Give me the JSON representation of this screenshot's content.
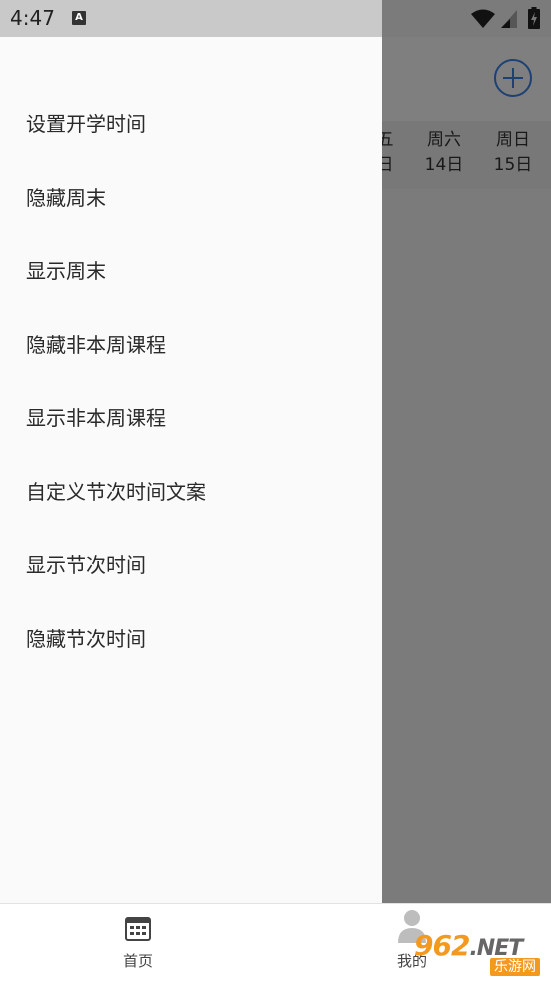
{
  "status_bar": {
    "time": "4:47",
    "notification_icon": "A"
  },
  "app": {
    "week_days": [
      {
        "name": "五",
        "date": "日"
      },
      {
        "name": "周六",
        "date": "14日"
      },
      {
        "name": "周日",
        "date": "15日"
      }
    ],
    "add_icon": "plus-circle-icon"
  },
  "drawer": {
    "items": [
      {
        "label": "设置开学时间"
      },
      {
        "label": "隐藏周末"
      },
      {
        "label": "显示周末"
      },
      {
        "label": "隐藏非本周课程"
      },
      {
        "label": "显示非本周课程"
      },
      {
        "label": "自定义节次时间文案"
      },
      {
        "label": "显示节次时间"
      },
      {
        "label": "隐藏节次时间"
      }
    ]
  },
  "bottom_nav": {
    "home_label": "首页",
    "mine_label": "我的"
  },
  "watermark": {
    "brand": "962",
    "suffix": ".NET",
    "site": "乐游网"
  },
  "colors": {
    "accent": "#3b82e8",
    "watermark": "#f39a1e"
  }
}
